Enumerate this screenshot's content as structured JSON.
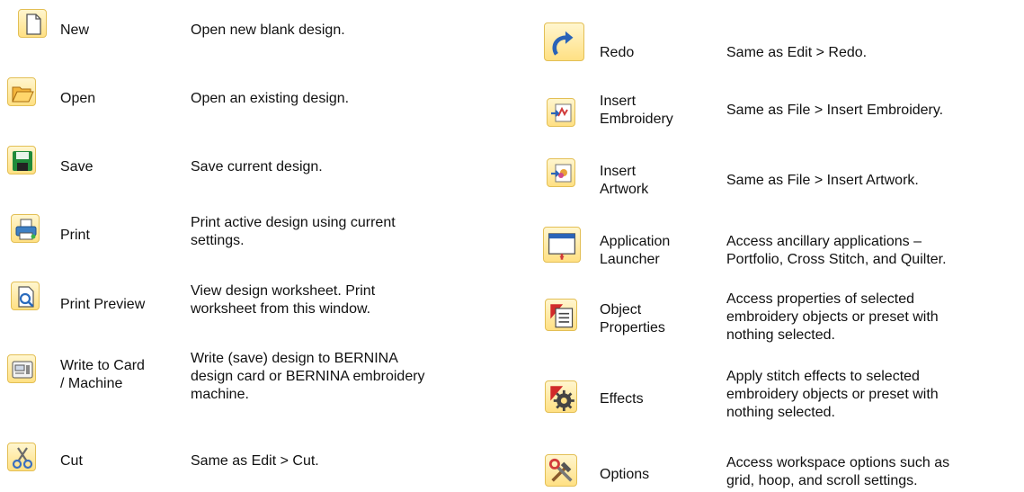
{
  "left_column": [
    {
      "icon": "new-document-icon",
      "name": [
        "New"
      ],
      "desc": [
        "Open new blank design."
      ]
    },
    {
      "icon": "open-folder-icon",
      "name": [
        "Open"
      ],
      "desc": [
        "Open an existing design."
      ]
    },
    {
      "icon": "save-disk-icon",
      "name": [
        "Save"
      ],
      "desc": [
        "Save current design."
      ]
    },
    {
      "icon": "printer-icon",
      "name": [
        "Print"
      ],
      "desc": [
        "Print active design using current",
        "settings."
      ]
    },
    {
      "icon": "print-preview-icon",
      "name": [
        "Print Preview"
      ],
      "desc": [
        "View design worksheet. Print",
        "worksheet from this window."
      ]
    },
    {
      "icon": "write-to-card-icon",
      "name": [
        "Write to Card",
        "/ Machine"
      ],
      "desc": [
        "Write (save) design to BERNINA",
        "design card or BERNINA embroidery",
        "machine."
      ]
    },
    {
      "icon": "scissors-icon",
      "name": [
        "Cut"
      ],
      "desc": [
        "Same as Edit > Cut."
      ]
    }
  ],
  "right_column": [
    {
      "icon": "redo-arrow-icon",
      "name": [
        "Redo"
      ],
      "desc": [
        "Same as Edit > Redo."
      ]
    },
    {
      "icon": "insert-embroidery-icon",
      "name": [
        "Insert",
        "Embroidery"
      ],
      "desc": [
        "Same as File > Insert Embroidery."
      ]
    },
    {
      "icon": "insert-artwork-icon",
      "name": [
        "Insert",
        "Artwork"
      ],
      "desc": [
        "Same as File > Insert Artwork."
      ]
    },
    {
      "icon": "application-launcher-icon",
      "name": [
        "Application",
        "Launcher"
      ],
      "desc": [
        "Access ancillary applications –",
        "Portfolio, Cross Stitch, and Quilter."
      ]
    },
    {
      "icon": "object-properties-icon",
      "name": [
        "Object",
        "Properties"
      ],
      "desc": [
        "Access properties of selected",
        "embroidery objects or preset with",
        "nothing selected."
      ]
    },
    {
      "icon": "effects-gear-icon",
      "name": [
        "Effects"
      ],
      "desc": [
        "Apply stitch effects to selected",
        "embroidery objects or preset with",
        "nothing selected."
      ]
    },
    {
      "icon": "options-tools-icon",
      "name": [
        "Options"
      ],
      "desc": [
        "Access workspace options such as",
        "grid, hoop, and scroll settings."
      ]
    }
  ]
}
